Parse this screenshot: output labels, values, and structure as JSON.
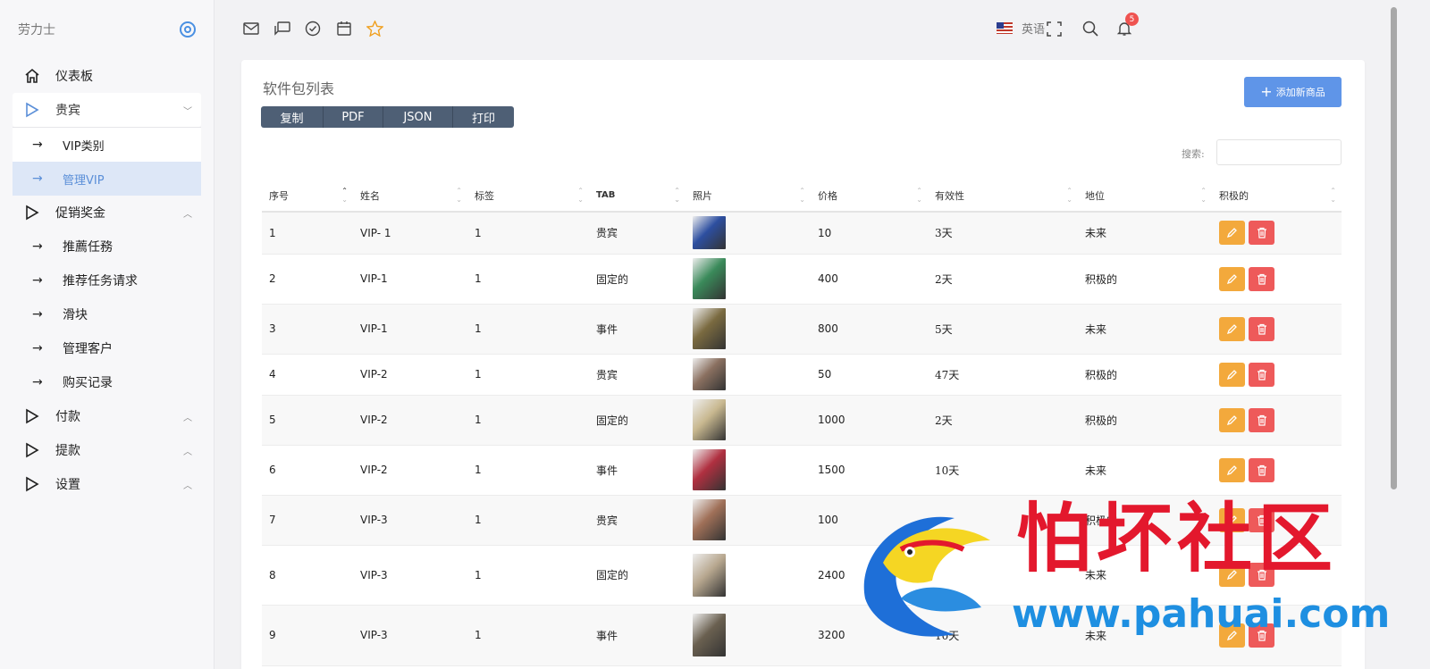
{
  "brand": {
    "name": "劳力士"
  },
  "sidebar": {
    "items": [
      {
        "label": "仪表板"
      },
      {
        "label": "贵宾",
        "chevron": "﹀"
      },
      {
        "label": "VIP类别"
      },
      {
        "label": "管理VIP"
      },
      {
        "label": "促销奖金",
        "chevron": "︿"
      },
      {
        "label": "推薦任務"
      },
      {
        "label": "推荐任务请求"
      },
      {
        "label": "滑块"
      },
      {
        "label": "管理客户"
      },
      {
        "label": "购买记录"
      },
      {
        "label": "付款",
        "chevron": "︿"
      },
      {
        "label": "提款",
        "chevron": "︿"
      },
      {
        "label": "设置",
        "chevron": "︿"
      }
    ]
  },
  "topbar": {
    "language": "英语",
    "notification_count": "5",
    "icons": [
      "mail-icon",
      "chat-icon",
      "check-circle-icon",
      "calendar-icon",
      "star-icon",
      "fullscreen-icon",
      "search-icon",
      "bell-icon"
    ]
  },
  "card": {
    "title": "软件包列表",
    "buttons": [
      "复制",
      "PDF",
      "JSON",
      "打印"
    ],
    "add_button": "添加新商品",
    "search_label": "搜索:"
  },
  "table": {
    "headers": [
      "序号",
      "姓名",
      "标签",
      "TAB",
      "照片",
      "价格",
      "有效性",
      "地位",
      "积极的"
    ],
    "rows": [
      {
        "no": "1",
        "name": "VIP- 1",
        "tag": "1",
        "tab": "贵宾",
        "price": "10",
        "validity": "3天",
        "status": "未来",
        "photo_color": "#2d4fa0"
      },
      {
        "no": "2",
        "name": "VIP-1",
        "tag": "1",
        "tab": "固定的",
        "price": "400",
        "validity": "2天",
        "status": "积极的",
        "photo_color": "#3a8a5a"
      },
      {
        "no": "3",
        "name": "VIP-1",
        "tag": "1",
        "tab": "事件",
        "price": "800",
        "validity": "5天",
        "status": "未来",
        "photo_color": "#7a6a40"
      },
      {
        "no": "4",
        "name": "VIP-2",
        "tag": "1",
        "tab": "贵宾",
        "price": "50",
        "validity": "47天",
        "status": "积极的",
        "photo_color": "#8a7060"
      },
      {
        "no": "5",
        "name": "VIP-2",
        "tag": "1",
        "tab": "固定的",
        "price": "1000",
        "validity": "2天",
        "status": "积极的",
        "photo_color": "#c8b890"
      },
      {
        "no": "6",
        "name": "VIP-2",
        "tag": "1",
        "tab": "事件",
        "price": "1500",
        "validity": "10天",
        "status": "未来",
        "photo_color": "#b03040"
      },
      {
        "no": "7",
        "name": "VIP-3",
        "tag": "1",
        "tab": "贵宾",
        "price": "100",
        "validity": "",
        "status": "积极的",
        "photo_color": "#a07058"
      },
      {
        "no": "8",
        "name": "VIP-3",
        "tag": "1",
        "tab": "固定的",
        "price": "2400",
        "validity": "",
        "status": "未来",
        "photo_color": "#b8a890"
      },
      {
        "no": "9",
        "name": "VIP-3",
        "tag": "1",
        "tab": "事件",
        "price": "3200",
        "validity": "10天",
        "status": "未来",
        "photo_color": "#6a6050"
      }
    ]
  },
  "watermark": {
    "text": "怕坏社区",
    "url": "www.pahuai.com"
  },
  "colors": {
    "accent": "#5f95e8",
    "edit": "#f3a93c",
    "delete": "#ee5a5a",
    "active_bg": "#dde7f7"
  }
}
